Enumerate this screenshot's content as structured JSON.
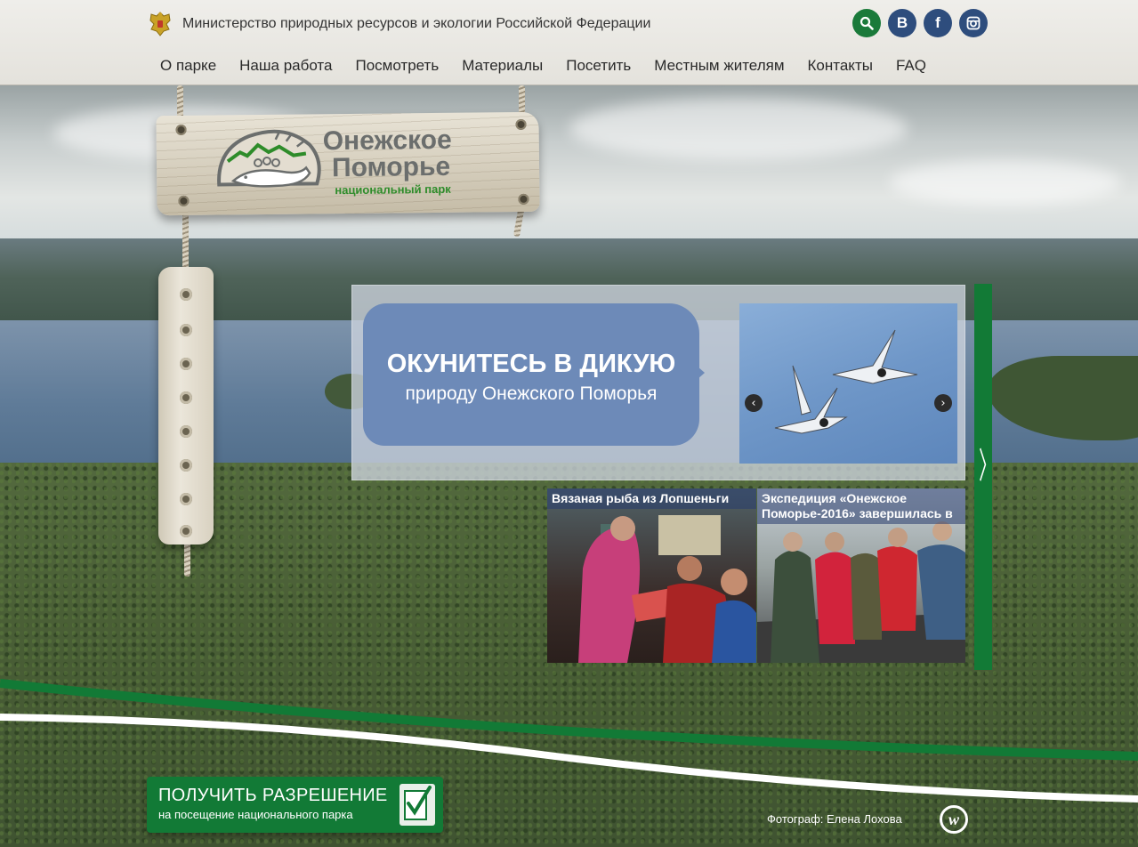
{
  "header": {
    "ministry_name": "Министерство природных ресурсов и экологии Российской Федерации",
    "social": {
      "vk_label": "В",
      "facebook_label": "f"
    }
  },
  "nav": {
    "items": [
      {
        "label": "О парке"
      },
      {
        "label": "Наша работа"
      },
      {
        "label": "Посмотреть"
      },
      {
        "label": "Материалы"
      },
      {
        "label": "Посетить"
      },
      {
        "label": "Местным жителям"
      },
      {
        "label": "Контакты"
      },
      {
        "label": "FAQ"
      }
    ]
  },
  "logo": {
    "title_line1": "Онежское",
    "title_line2": "Поморье",
    "subtitle": "национальный парк"
  },
  "slider": {
    "headline": "ОКУНИТЕСЬ В ДИКУЮ",
    "subheadline": "природу Онежского Поморья",
    "prev_symbol": "‹",
    "next_symbol": "›",
    "panel_next_symbol": "〉"
  },
  "news": [
    {
      "title": "Вязаная рыба из Лопшеньги"
    },
    {
      "title": "Экспедиция «Онежское Поморье-2016» завершилась в"
    }
  ],
  "permit": {
    "title": "ПОЛУЧИТЬ РАЗРЕШЕНИЕ",
    "subtitle": "на посещение национального парка"
  },
  "footer": {
    "photographer": "Фотограф: Елена Лохова",
    "badge_letter": "w"
  },
  "colors": {
    "brand_green": "#127a36",
    "bubble_blue": "#6d8ab8",
    "social_blue": "#2e4d7d"
  }
}
